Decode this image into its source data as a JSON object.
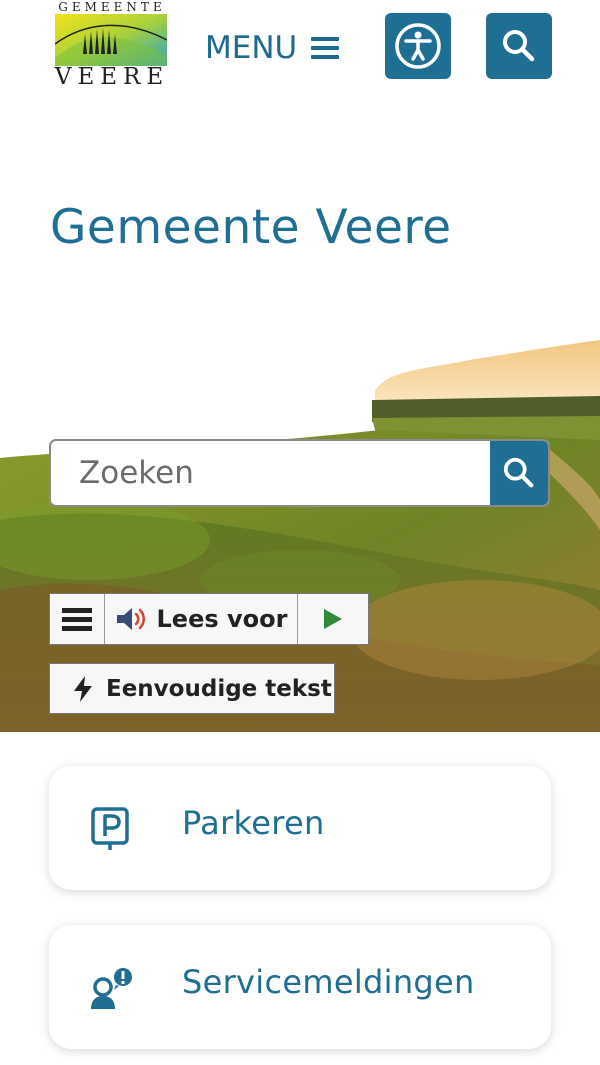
{
  "header": {
    "logo_top": "GEMEENTE",
    "logo_bottom": "VEERE",
    "menu_label": "MENU",
    "accessibility_icon": "accessibility-icon",
    "search_icon": "search-icon"
  },
  "page_title": "Gemeente Veere",
  "search": {
    "placeholder": "Zoeken",
    "value": ""
  },
  "readspeaker": {
    "menu_icon": "hamburger-icon",
    "label": "Lees voor",
    "speaker_icon": "speaker-icon",
    "play_icon": "play-icon"
  },
  "simple_text": {
    "icon": "bolt-icon",
    "label": "Eenvoudige tekst"
  },
  "cards": [
    {
      "label": "Parkeren",
      "icon": "parking-icon"
    },
    {
      "label": "Servicemeldingen",
      "icon": "service-report-icon"
    }
  ],
  "colors": {
    "primary": "#1f6e94",
    "title": "#1f6e94",
    "play_green": "#2e8b3a",
    "speaker_red": "#d9412b"
  }
}
